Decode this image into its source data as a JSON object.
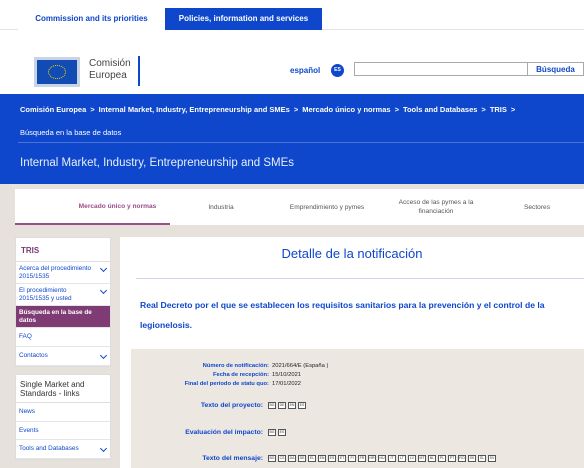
{
  "top_tabs": {
    "commission": "Commission and its priorities",
    "policies": "Policies, information and services"
  },
  "header": {
    "logo_line1": "Comisión",
    "logo_line2": "Europea",
    "language": "español",
    "language_code": "ES",
    "search_placeholder": "",
    "search_button": "Búsqueda"
  },
  "breadcrumb": {
    "items": [
      "Comisión Europea",
      "Internal Market, Industry, Entrepreneurship and SMEs",
      "Mercado único y normas",
      "Tools and Databases",
      "TRIS"
    ],
    "separator": ">",
    "current": "Búsqueda en la base de datos"
  },
  "site_title": "Internal Market, Industry, Entrepreneurship and SMEs",
  "nav": {
    "items": [
      "Mercado único y normas",
      "Industria",
      "Emprendimiento y pymes",
      "Acceso de las pymes a la financiación",
      "Sectores"
    ]
  },
  "sidebar": {
    "title": "TRIS",
    "items": [
      "Acerca del procedimiento 2015/1535",
      "El procedimiento 2015/1535 y usted",
      "Búsqueda en la base de datos",
      "FAQ",
      "Contactos"
    ],
    "box2_title": "Single Market and Standards - links",
    "box2_items": [
      "News",
      "Events",
      "Tools and Databases"
    ]
  },
  "main": {
    "title": "Detalle de la notificación",
    "notification_title": "Real Decreto por el que se establecen los requisitos sanitarios para la prevención y el control de la legionelosis.",
    "details": {
      "number_label": "Número de notificación:",
      "number_value": "2021/664/E (España )",
      "date_label": "Fecha de recepción:",
      "date_value": "15/10/2021",
      "statu_quo_label": "Final del período de statu quo:",
      "statu_quo_value": "17/01/2022",
      "project_text_label": "Texto del proyecto:",
      "project_text_docs": [
        "BG",
        "DE",
        "EN",
        "ES"
      ],
      "impact_label": "Evaluación del impacto:",
      "impact_docs": [
        "BG",
        "ES"
      ],
      "message_label": "Texto del mensaje:",
      "message_docs": [
        "BG",
        "CS",
        "DA",
        "DE",
        "EL",
        "EN",
        "ES",
        "ET",
        "FI",
        "FR",
        "HR",
        "HU",
        "IT",
        "LT",
        "LV",
        "MT",
        "NL",
        "PL",
        "PT",
        "RO",
        "SK",
        "SL",
        "SV"
      ]
    }
  },
  "colors": {
    "ec_blue": "#0e47cb",
    "purple": "#7f3b73",
    "beige": "#e7e1db"
  }
}
